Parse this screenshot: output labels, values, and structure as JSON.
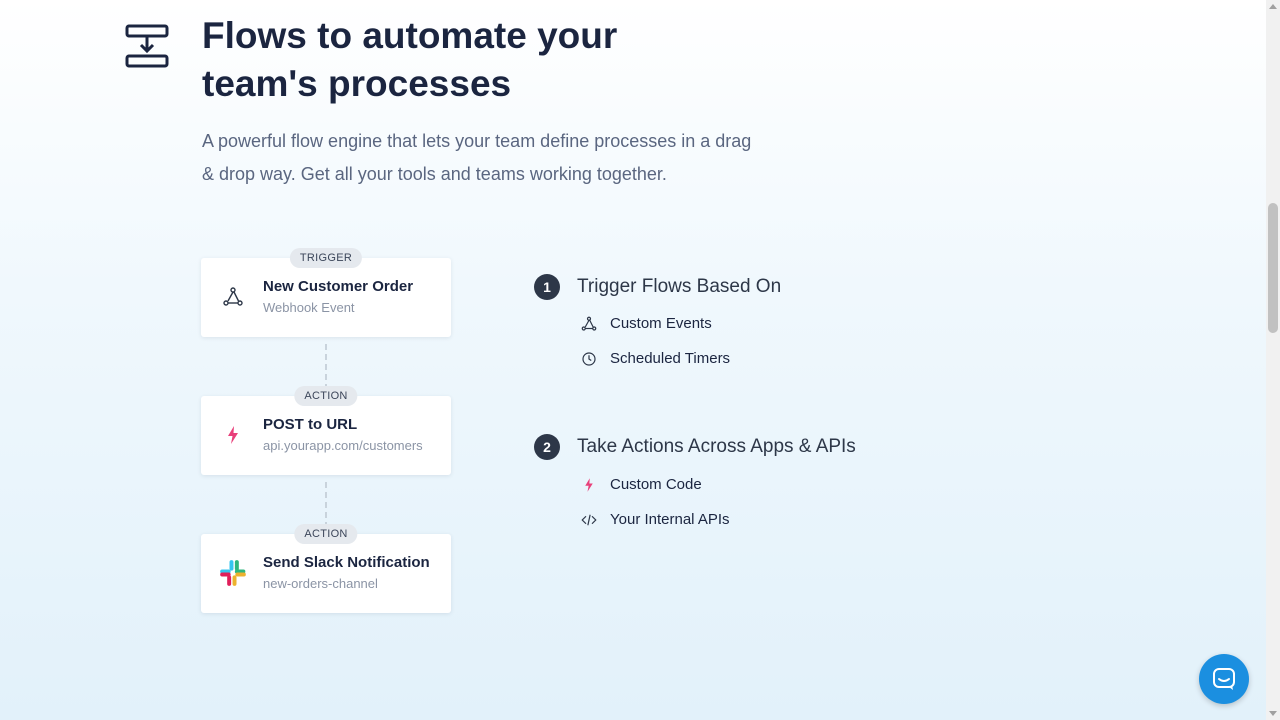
{
  "header": {
    "icon": "flow-download-icon",
    "title": "Flows to automate your team's processes",
    "subtitle": "A powerful flow engine that lets your team define processes in a drag & drop way. Get all your tools and teams working together."
  },
  "flow_cards": [
    {
      "badge": "TRIGGER",
      "icon": "webhook-icon",
      "title": "New Customer Order",
      "subtitle": "Webhook Event"
    },
    {
      "badge": "ACTION",
      "icon": "lightning-icon",
      "title": "POST to URL",
      "subtitle": "api.yourapp.com/customers"
    },
    {
      "badge": "ACTION",
      "icon": "slack-icon",
      "title": "Send Slack Notification",
      "subtitle": "new-orders-channel"
    }
  ],
  "steps": [
    {
      "number": "1",
      "title": "Trigger Flows Based On",
      "features": [
        {
          "icon": "webhook-icon",
          "label": "Custom Events"
        },
        {
          "icon": "clock-icon",
          "label": "Scheduled Timers"
        }
      ]
    },
    {
      "number": "2",
      "title": "Take Actions Across Apps & APIs",
      "features": [
        {
          "icon": "lightning-icon",
          "label": "Custom Code"
        },
        {
          "icon": "code-icon",
          "label": "Your Internal APIs"
        }
      ]
    }
  ],
  "colors": {
    "heading": "#1b2540",
    "accent_pink": "#e8407a",
    "chat_blue": "#1b8fe0"
  },
  "chat_widget": {
    "icon": "chat-icon"
  }
}
